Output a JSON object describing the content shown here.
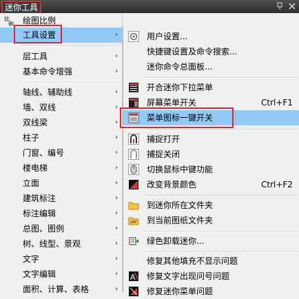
{
  "window": {
    "title": "迷你工具"
  },
  "menu1": {
    "items": [
      {
        "label": "绘图比例",
        "arrow": "",
        "icon": "scale-icon"
      },
      {
        "label": "工具设置",
        "arrow": "›",
        "icon": ""
      },
      {
        "label": "层工具",
        "arrow": "›",
        "icon": ""
      },
      {
        "label": "基本命令增强",
        "arrow": "›",
        "icon": ""
      },
      {
        "label": "轴线、辅助线",
        "arrow": "›",
        "icon": ""
      },
      {
        "label": "墙、双线",
        "arrow": "›",
        "icon": ""
      },
      {
        "label": "双线梁",
        "arrow": "›",
        "icon": ""
      },
      {
        "label": "柱子",
        "arrow": "›",
        "icon": ""
      },
      {
        "label": "门窗、编号",
        "arrow": "›",
        "icon": ""
      },
      {
        "label": "楼电梯",
        "arrow": "›",
        "icon": ""
      },
      {
        "label": "立面",
        "arrow": "›",
        "icon": ""
      },
      {
        "label": "建筑标注",
        "arrow": "›",
        "icon": ""
      },
      {
        "label": "标注编辑",
        "arrow": "›",
        "icon": ""
      },
      {
        "label": "总图、图例",
        "arrow": "›",
        "icon": ""
      },
      {
        "label": "树、线型、景观",
        "arrow": "›",
        "icon": ""
      },
      {
        "label": "文字",
        "arrow": "›",
        "icon": ""
      },
      {
        "label": "文字编辑",
        "arrow": "›",
        "icon": ""
      },
      {
        "label": "面积、计算、表格",
        "arrow": "›",
        "icon": ""
      }
    ]
  },
  "menu2": {
    "items": [
      {
        "label": "用户设置...",
        "shortcut": "",
        "icon": "gear-icon"
      },
      {
        "label": "快捷键设置及命令搜索...",
        "shortcut": "",
        "icon": ""
      },
      {
        "label": "迷你命令总面板...",
        "shortcut": "",
        "icon": ""
      },
      {
        "label": "开合迷你下拉菜单",
        "shortcut": "",
        "icon": "pulldown-menu-icon"
      },
      {
        "label": "屏幕菜单开关",
        "shortcut": "Ctrl+F1",
        "icon": "screen-menu-icon"
      },
      {
        "label": "菜单图标一键开关",
        "shortcut": "",
        "icon": "menu-icon-toggle-icon"
      },
      {
        "label": "捕捉打开",
        "shortcut": "",
        "icon": "snap-on-icon"
      },
      {
        "label": "捕捉关闭",
        "shortcut": "",
        "icon": "snap-off-icon"
      },
      {
        "label": "切换鼠标中键功能",
        "shortcut": "",
        "icon": "mouse-icon"
      },
      {
        "label": "改变背景颜色",
        "shortcut": "Ctrl+F2",
        "icon": "background-color-icon"
      },
      {
        "label": "到迷你所在文件夹",
        "shortcut": "",
        "icon": "folder-icon"
      },
      {
        "label": "到当前图纸文件夹",
        "shortcut": "",
        "icon": "folder-drawing-icon"
      },
      {
        "label": "绿色卸载迷你...",
        "shortcut": "",
        "icon": "uninstall-icon"
      },
      {
        "label": "修复其他填充不显示问题",
        "shortcut": "",
        "icon": ""
      },
      {
        "label": "修复文字出现问号问题",
        "shortcut": "",
        "icon": "text-fix-icon"
      },
      {
        "label": "修复迷你菜单问题",
        "shortcut": "",
        "icon": "menu-fix-icon"
      }
    ]
  },
  "colors": {
    "highlight": "#91c9f7",
    "annotation": "#e0262e",
    "titlebar": "#3b3b3b"
  }
}
